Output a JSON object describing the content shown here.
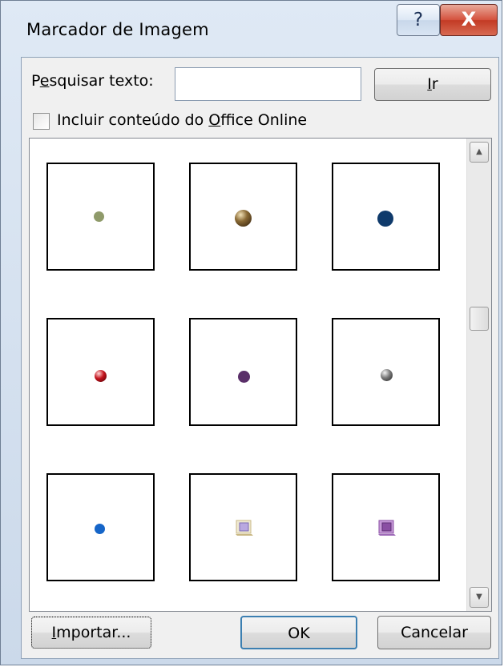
{
  "dialog": {
    "title": "Marcador de Imagem",
    "help_label": "?",
    "close_label": "X"
  },
  "search": {
    "label_prefix": "P",
    "label_underlined": "e",
    "label_suffix": "squisar texto:",
    "value": "",
    "placeholder": "",
    "go_underlined": "I",
    "go_suffix": "r"
  },
  "office_online": {
    "checked": false,
    "label_prefix": "Incluir conteúdo do ",
    "label_underlined": "O",
    "label_suffix": "ffice Online"
  },
  "bullets": [
    {
      "name": "olive-dot-bullet",
      "color": "#8f9a6a",
      "icon": "small-round-bullet"
    },
    {
      "name": "bronze-sphere-bullet",
      "color": "#6b4a1f",
      "icon": "sphere-bullet"
    },
    {
      "name": "navy-dot-bullet",
      "color": "#0f3a6b",
      "icon": "round-bullet"
    },
    {
      "name": "red-sphere-bullet",
      "color": "#b3131c",
      "icon": "sphere-bullet"
    },
    {
      "name": "purple-dot-bullet",
      "color": "#5a2f69",
      "icon": "round-bullet"
    },
    {
      "name": "gray-sphere-bullet",
      "color": "#555555",
      "icon": "sphere-bullet"
    },
    {
      "name": "blue-dot-bullet",
      "color": "#1565c8",
      "icon": "small-round-bullet"
    },
    {
      "name": "square-frame-bullet-gold",
      "color": "#9a86c9",
      "icon": "square-frame-bullet"
    },
    {
      "name": "square-frame-bullet-purple",
      "color": "#8a4fa3",
      "icon": "square-frame-bullet"
    }
  ],
  "buttons": {
    "import_underlined": "I",
    "import_suffix": "mportar...",
    "ok": "OK",
    "cancel": "Cancelar"
  }
}
